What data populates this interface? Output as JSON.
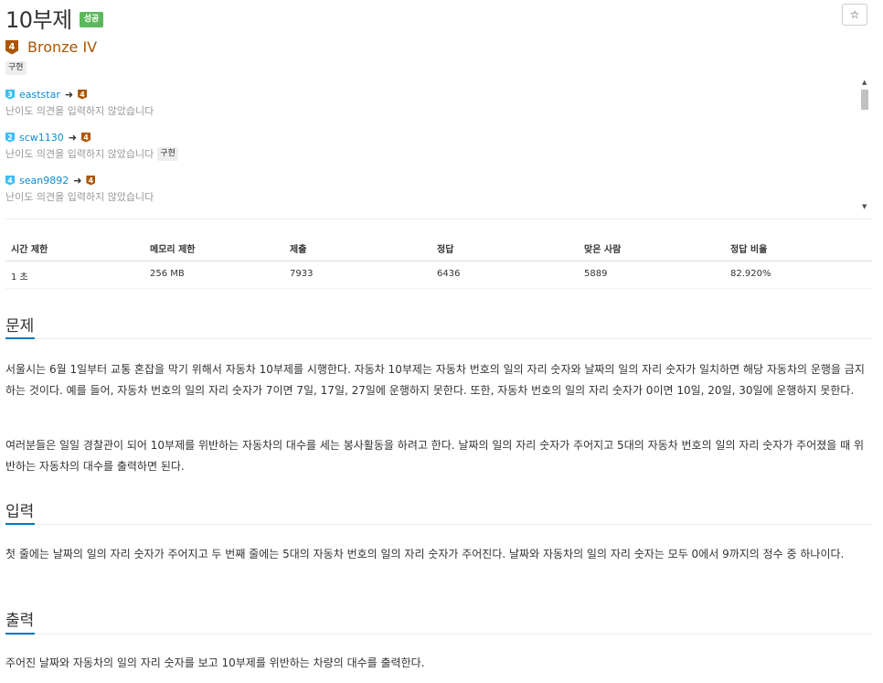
{
  "header": {
    "title": "10부제",
    "status_badge": "성공",
    "star": "☆"
  },
  "tier": {
    "number": "4",
    "name": "Bronze IV",
    "color": "#ad5600"
  },
  "tags": [
    "구현"
  ],
  "opinions": [
    {
      "from_tier": "3",
      "from_color": "#38bdf8",
      "user": "eaststar",
      "arrow": "➜",
      "to_tier": "4",
      "note": "난이도 의견을 입력하지 않았습니다",
      "tag": ""
    },
    {
      "from_tier": "2",
      "from_color": "#38bdf8",
      "user": "scw1130",
      "arrow": "➜",
      "to_tier": "4",
      "note": "난이도 의견을 입력하지 않았습니다",
      "tag": "구현"
    },
    {
      "from_tier": "4",
      "from_color": "#38bdf8",
      "user": "sean9892",
      "arrow": "➜",
      "to_tier": "4",
      "note": "난이도 의견을 입력하지 않았습니다",
      "tag": ""
    }
  ],
  "stats": {
    "headers": [
      "시간 제한",
      "메모리 제한",
      "제출",
      "정답",
      "맞은 사람",
      "정답 비율"
    ],
    "values": [
      "1 초",
      "256 MB",
      "7933",
      "6436",
      "5889",
      "82.920%"
    ]
  },
  "sections": {
    "problem": {
      "title": "문제",
      "paragraphs": [
        "서울시는 6월 1일부터 교통 혼잡을 막기 위해서 자동차 10부제를 시행한다. 자동차 10부제는 자동차 번호의 일의 자리 숫자와 날짜의 일의 자리 숫자가 일치하면 해당 자동차의 운행을 금지하는 것이다. 예를 들어, 자동차 번호의 일의 자리 숫자가 7이면 7일, 17일, 27일에 운행하지 못한다. 또한, 자동차 번호의 일의 자리 숫자가 0이면 10일, 20일, 30일에 운행하지 못한다.",
        "여러분들은 일일 경찰관이 되어 10부제를 위반하는 자동차의 대수를 세는 봉사활동을 하려고 한다. 날짜의 일의 자리 숫자가 주어지고 5대의 자동차 번호의 일의 자리 숫자가 주어졌을 때 위반하는 자동차의 대수를 출력하면 된다."
      ]
    },
    "input": {
      "title": "입력",
      "paragraphs": [
        "첫 줄에는 날짜의 일의 자리 숫자가 주어지고 두 번째 줄에는 5대의 자동차 번호의 일의 자리 숫자가 주어진다. 날짜와 자동차의 일의 자리 숫자는 모두 0에서 9까지의 정수 중 하나이다."
      ]
    },
    "output": {
      "title": "출력",
      "paragraphs": [
        "주어진 날짜와 자동차의 일의 자리 숫자를 보고 10부제를 위반하는 차량의 대수를 출력한다."
      ]
    }
  }
}
